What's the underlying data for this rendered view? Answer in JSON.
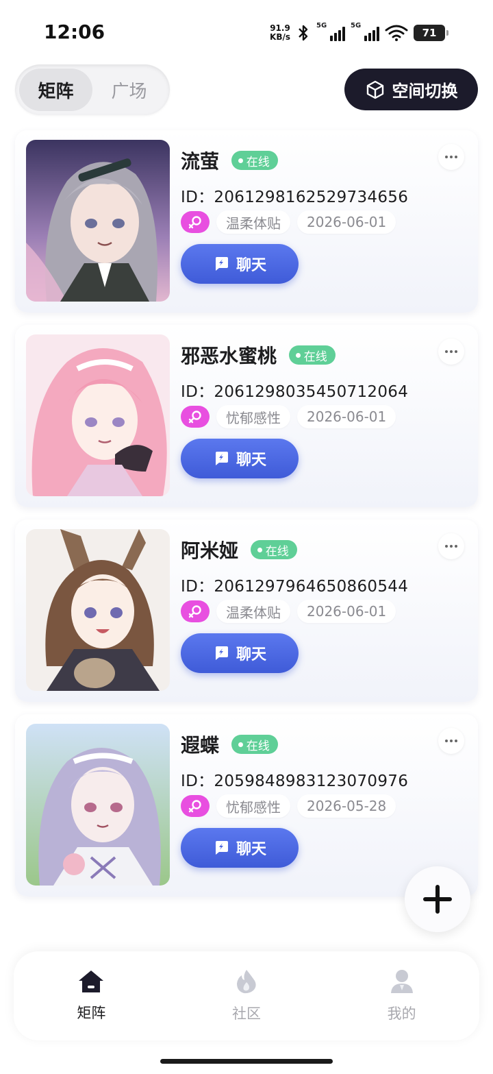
{
  "status": {
    "time": "12:06",
    "net_speed_value": "91.9",
    "net_speed_unit": "KB/s",
    "sim1": "5G",
    "sim2": "5G",
    "battery": "71"
  },
  "top": {
    "tabs": [
      "矩阵",
      "广场"
    ],
    "active_tab": "矩阵",
    "space_switch_label": "空间切换"
  },
  "characters": [
    {
      "name": "流萤",
      "status": "在线",
      "id": "ID：2061298162529734656",
      "trait": "温柔体贴",
      "date": "2026-06-01",
      "chat": "聊天"
    },
    {
      "name": "邪恶水蜜桃",
      "status": "在线",
      "id": "ID：2061298035450712064",
      "trait": "忧郁感性",
      "date": "2026-06-01",
      "chat": "聊天"
    },
    {
      "name": "阿米娅",
      "status": "在线",
      "id": "ID：2061297964650860544",
      "trait": "温柔体贴",
      "date": "2026-06-01",
      "chat": "聊天"
    },
    {
      "name": "遐蝶",
      "status": "在线",
      "id": "ID：2059848983123070976",
      "trait": "忧郁感性",
      "date": "2026-05-28",
      "chat": "聊天"
    }
  ],
  "nav": {
    "items": [
      {
        "label": "矩阵",
        "icon": "home-icon"
      },
      {
        "label": "社区",
        "icon": "flame-icon"
      },
      {
        "label": "我的",
        "icon": "user-icon"
      }
    ]
  },
  "colors": {
    "accent": "#4a66e0",
    "online": "#5fcf97",
    "gender": "#e84fe0",
    "dark_button": "#1c1b2b"
  }
}
